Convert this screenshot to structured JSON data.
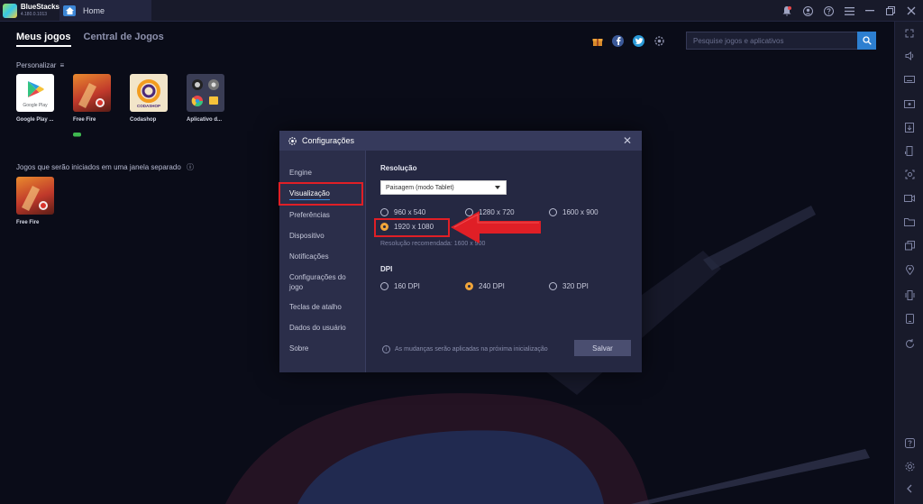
{
  "titlebar": {
    "brand": "BlueStacks",
    "version": "4.180.0.1013",
    "tab_home": "Home"
  },
  "nav": {
    "tabs": [
      "Meus jogos",
      "Central de Jogos"
    ]
  },
  "search": {
    "placeholder": "Pesquise jogos e aplicativos"
  },
  "personalize": {
    "label": "Personalizar"
  },
  "apps": [
    {
      "name": "Google Play ..."
    },
    {
      "name": "Free Fire"
    },
    {
      "name": "Codashop"
    },
    {
      "name": "Aplicativo d..."
    }
  ],
  "separate_window": {
    "label": "Jogos que serão iniciados em uma janela separado",
    "apps": [
      {
        "name": "Free Fire"
      }
    ]
  },
  "tile_text": {
    "google_play": "Google Play",
    "coda": "CODASHOP"
  },
  "dialog": {
    "title": "Configurações",
    "sidebar": [
      "Engine",
      "Visualização",
      "Preferências",
      "Dispositivo",
      "Notificações",
      "Configurações do jogo",
      "Teclas de atalho",
      "Dados do usuário",
      "Sobre"
    ],
    "active_item": "Visualização",
    "resolution_label": "Resolução",
    "mode_value": "Paisagem (modo Tablet)",
    "resolutions": [
      "960 x 540",
      "1280 x 720",
      "1600 x 900",
      "1920 x 1080"
    ],
    "selected_resolution": "1920 x 1080",
    "recommended": "Resolução recomendada: 1600 x 900",
    "dpi_label": "DPI",
    "dpis": [
      "160 DPI",
      "240 DPI",
      "320 DPI"
    ],
    "selected_dpi": "240 DPI",
    "notice": "As mudanças serão aplicadas na próxima inicialização",
    "save": "Salvar"
  },
  "colors": {
    "accent_orange": "#f0a53a",
    "annotation_red": "#e01f26",
    "search_blue": "#2d7fd0"
  },
  "icons": [
    "notification-icon",
    "account-icon",
    "help-icon",
    "menu-icon",
    "minimize-icon",
    "restore-icon",
    "close-icon",
    "gift-icon",
    "facebook-icon",
    "twitter-icon",
    "settings-icon",
    "search-icon"
  ]
}
